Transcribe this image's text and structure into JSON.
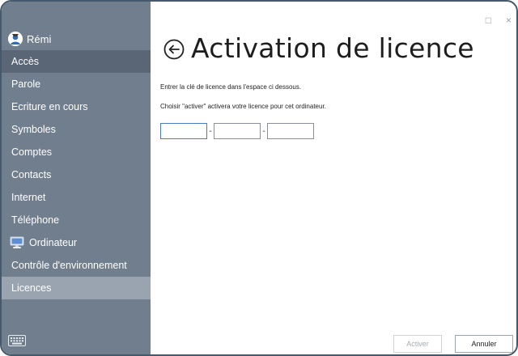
{
  "user": {
    "name": "Rémi",
    "avatar_icon": "user-avatar-icon"
  },
  "sidebar": {
    "items": [
      {
        "label": "Accès"
      },
      {
        "label": "Parole"
      },
      {
        "label": "Ecriture en cours"
      },
      {
        "label": "Symboles"
      },
      {
        "label": "Comptes"
      },
      {
        "label": "Contacts"
      },
      {
        "label": "Internet"
      },
      {
        "label": "Téléphone"
      },
      {
        "label": "Ordinateur",
        "icon": "computer-icon"
      },
      {
        "label": "Contrôle d'environnement"
      },
      {
        "label": "Licences",
        "active": true
      }
    ],
    "keyboard_icon": "keyboard-icon",
    "colors": {
      "background": "#717e8e",
      "header_item": "#5a6676",
      "active_item": "#9aa4b0"
    }
  },
  "window_controls": {
    "maximize": "□",
    "close": "×"
  },
  "main": {
    "title": "Activation de licence",
    "back_icon": "back-arrow-icon",
    "instructions": [
      "Entrer la clé de licence dans l'espace ci dessous.",
      "Choisir \"activer\" activera votre licence pour cet ordinateur."
    ],
    "key_fields": [
      {
        "value": "",
        "placeholder": ""
      },
      {
        "value": "",
        "placeholder": ""
      },
      {
        "value": "",
        "placeholder": ""
      }
    ],
    "separator": "-"
  },
  "buttons": {
    "activate": {
      "label": "Activer",
      "disabled": true
    },
    "cancel": {
      "label": "Annuler"
    }
  }
}
